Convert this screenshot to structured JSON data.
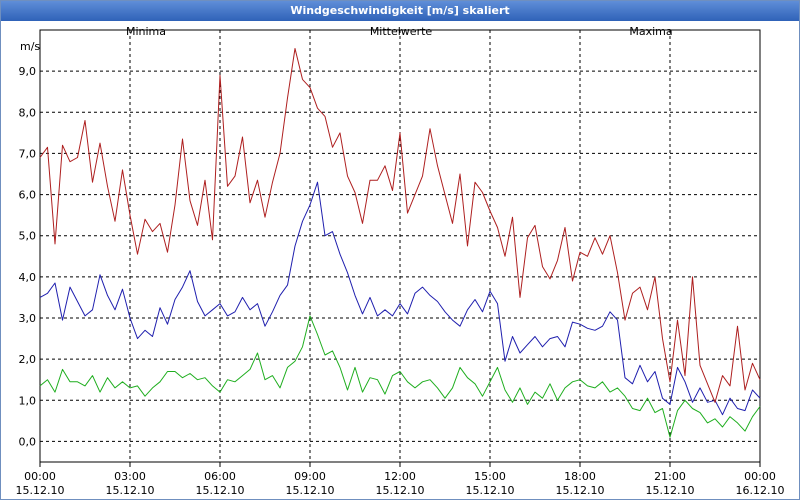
{
  "window": {
    "title": "Windgeschwindigkeit [m/s] skaliert"
  },
  "chart_data": {
    "type": "line",
    "title": "Windgeschwindigkeit [m/s] skaliert",
    "ylabel": "m/s",
    "ylim": [
      -0.5,
      10.0
    ],
    "yticks": [
      "0,0",
      "1,0",
      "2,0",
      "3,0",
      "4,0",
      "5,0",
      "6,0",
      "7,0",
      "8,0",
      "9,0"
    ],
    "ytick_values": [
      0,
      1,
      2,
      3,
      4,
      5,
      6,
      7,
      8,
      9
    ],
    "xlim_hours": [
      0,
      24
    ],
    "xticks": [
      {
        "time": "00:00",
        "date": "15.12.10"
      },
      {
        "time": "03:00",
        "date": "15.12.10"
      },
      {
        "time": "06:00",
        "date": "15.12.10"
      },
      {
        "time": "09:00",
        "date": "15.12.10"
      },
      {
        "time": "12:00",
        "date": "15.12.10"
      },
      {
        "time": "15:00",
        "date": "15.12.10"
      },
      {
        "time": "18:00",
        "date": "15.12.10"
      },
      {
        "time": "21:00",
        "date": "15.12.10"
      },
      {
        "time": "00:00",
        "date": "16.12.10"
      }
    ],
    "grid": true,
    "series": [
      {
        "name": "Minima",
        "color": "#1fae1f",
        "x": [
          0,
          0.25,
          0.5,
          0.75,
          1,
          1.25,
          1.5,
          1.75,
          2,
          2.25,
          2.5,
          2.75,
          3,
          3.25,
          3.5,
          3.75,
          4,
          4.25,
          4.5,
          4.75,
          5,
          5.25,
          5.5,
          5.75,
          6,
          6.25,
          6.5,
          6.75,
          7,
          7.25,
          7.5,
          7.75,
          8,
          8.25,
          8.5,
          8.75,
          9,
          9.25,
          9.5,
          9.75,
          10,
          10.25,
          10.5,
          10.75,
          11,
          11.25,
          11.5,
          11.75,
          12,
          12.25,
          12.5,
          12.75,
          13,
          13.25,
          13.5,
          13.75,
          14,
          14.25,
          14.5,
          14.75,
          15,
          15.25,
          15.5,
          15.75,
          16,
          16.25,
          16.5,
          16.75,
          17,
          17.25,
          17.5,
          17.75,
          18,
          18.25,
          18.5,
          18.75,
          19,
          19.25,
          19.5,
          19.75,
          20,
          20.25,
          20.5,
          20.75,
          21,
          21.25,
          21.5,
          21.75,
          22,
          22.25,
          22.5,
          22.75,
          23,
          23.25,
          23.5,
          23.75,
          24
        ],
        "values": [
          1.35,
          1.5,
          1.2,
          1.75,
          1.45,
          1.45,
          1.35,
          1.6,
          1.2,
          1.55,
          1.3,
          1.45,
          1.3,
          1.35,
          1.1,
          1.3,
          1.45,
          1.7,
          1.7,
          1.55,
          1.65,
          1.5,
          1.55,
          1.35,
          1.2,
          1.5,
          1.45,
          1.6,
          1.75,
          2.15,
          1.5,
          1.6,
          1.3,
          1.8,
          1.95,
          2.3,
          3.05,
          2.6,
          2.1,
          2.2,
          1.8,
          1.25,
          1.8,
          1.2,
          1.55,
          1.5,
          1.15,
          1.6,
          1.7,
          1.45,
          1.3,
          1.45,
          1.5,
          1.3,
          1.05,
          1.3,
          1.8,
          1.55,
          1.4,
          1.1,
          1.45,
          1.8,
          1.25,
          0.95,
          1.3,
          0.9,
          1.2,
          1.05,
          1.4,
          1.0,
          1.3,
          1.45,
          1.5,
          1.35,
          1.3,
          1.45,
          1.2,
          1.3,
          1.1,
          0.8,
          0.75,
          1.05,
          0.7,
          0.8,
          0.1,
          0.75,
          1.0,
          0.8,
          0.7,
          0.45,
          0.55,
          0.35,
          0.6,
          0.45,
          0.25,
          0.6,
          0.85
        ]
      },
      {
        "name": "Mittelwerte",
        "color": "#1f1fae",
        "x": [
          0,
          0.25,
          0.5,
          0.75,
          1,
          1.25,
          1.5,
          1.75,
          2,
          2.25,
          2.5,
          2.75,
          3,
          3.25,
          3.5,
          3.75,
          4,
          4.25,
          4.5,
          4.75,
          5,
          5.25,
          5.5,
          5.75,
          6,
          6.25,
          6.5,
          6.75,
          7,
          7.25,
          7.5,
          7.75,
          8,
          8.25,
          8.5,
          8.75,
          9,
          9.25,
          9.5,
          9.75,
          10,
          10.25,
          10.5,
          10.75,
          11,
          11.25,
          11.5,
          11.75,
          12,
          12.25,
          12.5,
          12.75,
          13,
          13.25,
          13.5,
          13.75,
          14,
          14.25,
          14.5,
          14.75,
          15,
          15.25,
          15.5,
          15.75,
          16,
          16.25,
          16.5,
          16.75,
          17,
          17.25,
          17.5,
          17.75,
          18,
          18.25,
          18.5,
          18.75,
          19,
          19.25,
          19.5,
          19.75,
          20,
          20.25,
          20.5,
          20.75,
          21,
          21.25,
          21.5,
          21.75,
          22,
          22.25,
          22.5,
          22.75,
          23,
          23.25,
          23.5,
          23.75,
          24
        ],
        "values": [
          3.5,
          3.6,
          3.85,
          2.95,
          3.75,
          3.4,
          3.05,
          3.2,
          4.05,
          3.55,
          3.2,
          3.7,
          3.0,
          2.5,
          2.7,
          2.55,
          3.25,
          2.85,
          3.45,
          3.75,
          4.15,
          3.4,
          3.05,
          3.2,
          3.35,
          3.05,
          3.15,
          3.5,
          3.2,
          3.35,
          2.8,
          3.15,
          3.55,
          3.8,
          4.75,
          5.35,
          5.75,
          6.3,
          5.0,
          5.1,
          4.55,
          4.1,
          3.55,
          3.1,
          3.5,
          3.05,
          3.2,
          3.05,
          3.35,
          3.1,
          3.6,
          3.75,
          3.55,
          3.4,
          3.15,
          2.95,
          2.8,
          3.2,
          3.45,
          3.15,
          3.65,
          3.35,
          1.95,
          2.55,
          2.15,
          2.35,
          2.55,
          2.3,
          2.5,
          2.55,
          2.3,
          2.9,
          2.85,
          2.75,
          2.7,
          2.8,
          3.15,
          2.95,
          1.55,
          1.4,
          1.85,
          1.45,
          1.7,
          1.05,
          0.9,
          1.8,
          1.45,
          0.95,
          1.3,
          0.95,
          1.0,
          0.65,
          1.05,
          0.8,
          0.75,
          1.25,
          1.05
        ]
      },
      {
        "name": "Maxima",
        "color": "#ae1f1f",
        "x": [
          0,
          0.25,
          0.5,
          0.75,
          1,
          1.25,
          1.5,
          1.75,
          2,
          2.25,
          2.5,
          2.75,
          3,
          3.25,
          3.5,
          3.75,
          4,
          4.25,
          4.5,
          4.75,
          5,
          5.25,
          5.5,
          5.75,
          6,
          6.25,
          6.5,
          6.75,
          7,
          7.25,
          7.5,
          7.75,
          8,
          8.25,
          8.5,
          8.75,
          9,
          9.25,
          9.5,
          9.75,
          10,
          10.25,
          10.5,
          10.75,
          11,
          11.25,
          11.5,
          11.75,
          12,
          12.25,
          12.5,
          12.75,
          13,
          13.25,
          13.5,
          13.75,
          14,
          14.25,
          14.5,
          14.75,
          15,
          15.25,
          15.5,
          15.75,
          16,
          16.25,
          16.5,
          16.75,
          17,
          17.25,
          17.5,
          17.75,
          18,
          18.25,
          18.5,
          18.75,
          19,
          19.25,
          19.5,
          19.75,
          20,
          20.25,
          20.5,
          20.75,
          21,
          21.25,
          21.5,
          21.75,
          22,
          22.25,
          22.5,
          22.75,
          23,
          23.25,
          23.5,
          23.75,
          24
        ],
        "values": [
          6.9,
          7.15,
          4.8,
          7.2,
          6.8,
          6.9,
          7.8,
          6.3,
          7.25,
          6.2,
          5.35,
          6.6,
          5.5,
          4.55,
          5.4,
          5.1,
          5.3,
          4.6,
          5.75,
          7.35,
          5.85,
          5.25,
          6.35,
          4.9,
          8.9,
          6.2,
          6.45,
          7.4,
          5.8,
          6.35,
          5.45,
          6.3,
          7.0,
          8.35,
          9.55,
          8.8,
          8.6,
          8.1,
          7.9,
          7.15,
          7.5,
          6.45,
          6.05,
          5.3,
          6.35,
          6.35,
          6.7,
          6.1,
          7.5,
          5.55,
          6.0,
          6.45,
          7.6,
          6.7,
          6.0,
          5.3,
          6.5,
          4.75,
          6.3,
          6.05,
          5.6,
          5.2,
          4.5,
          5.45,
          3.5,
          4.95,
          5.25,
          4.25,
          3.95,
          4.4,
          5.2,
          3.9,
          4.6,
          4.5,
          4.95,
          4.55,
          5.0,
          4.1,
          2.95,
          3.6,
          3.75,
          3.2,
          4.0,
          2.5,
          1.45,
          2.95,
          1.6,
          4.0,
          1.85,
          1.4,
          0.95,
          1.6,
          1.35,
          2.8,
          1.25,
          1.9,
          1.5
        ]
      }
    ]
  }
}
